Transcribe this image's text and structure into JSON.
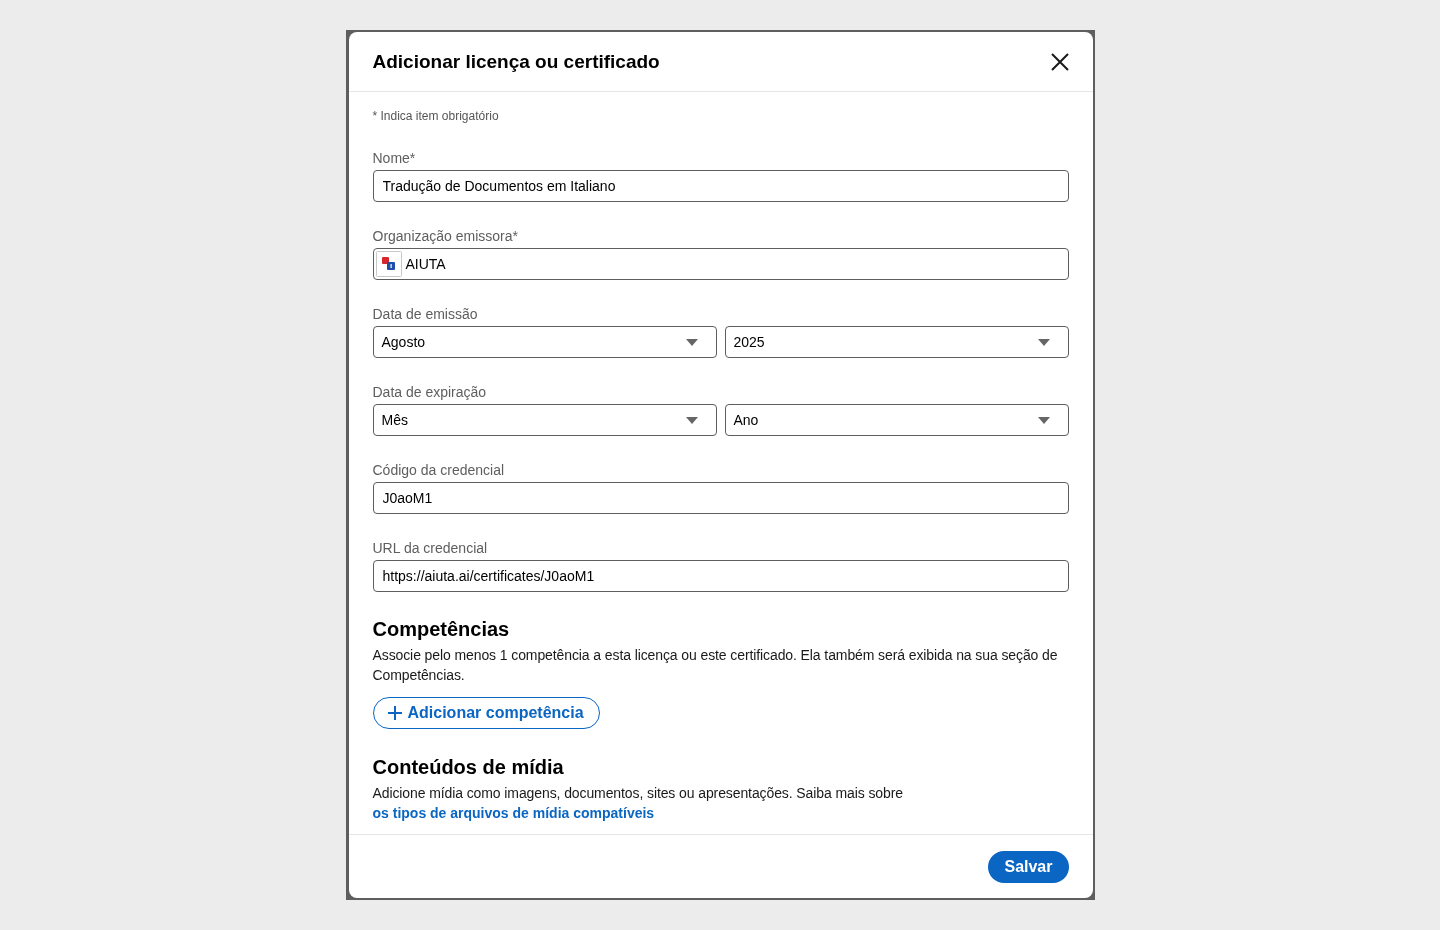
{
  "dialog": {
    "title": "Adicionar licença ou certificado"
  },
  "required_note": "* Indica item obrigatório",
  "fields": [
    {
      "kind": "text",
      "label": "Nome*",
      "value": "Tradução de Documentos em Italiano"
    },
    {
      "kind": "organization",
      "label": "Organização emissora*",
      "value": "AIUTA"
    },
    {
      "kind": "date",
      "label": "Data de emissão",
      "selects": [
        {
          "value": "Agosto"
        },
        {
          "value": "2025"
        }
      ]
    },
    {
      "kind": "date",
      "label": "Data de expiração",
      "selects": [
        {
          "value": "Mês"
        },
        {
          "value": "Ano"
        }
      ]
    },
    {
      "kind": "text",
      "label": "Código da credencial",
      "value": "J0aoM1"
    },
    {
      "kind": "text",
      "label": "URL da credencial",
      "value": "https://aiuta.ai/certificates/J0aoM1"
    }
  ],
  "sections": [
    {
      "kind": "skills",
      "heading": "Competências",
      "text": "Associe pelo menos 1 competência a esta licença ou este certificado. Ela também será exibida na sua seção de Competências.",
      "button": "Adicionar competência"
    },
    {
      "kind": "media",
      "heading": "Conteúdos de mídia",
      "text": "Adicione mídia como imagens, documentos, sites ou apresentações. Saiba mais sobre",
      "link": "os tipos de arquivos de mídia compatíveis"
    }
  ],
  "footer": {
    "save_button": "Salvar"
  }
}
